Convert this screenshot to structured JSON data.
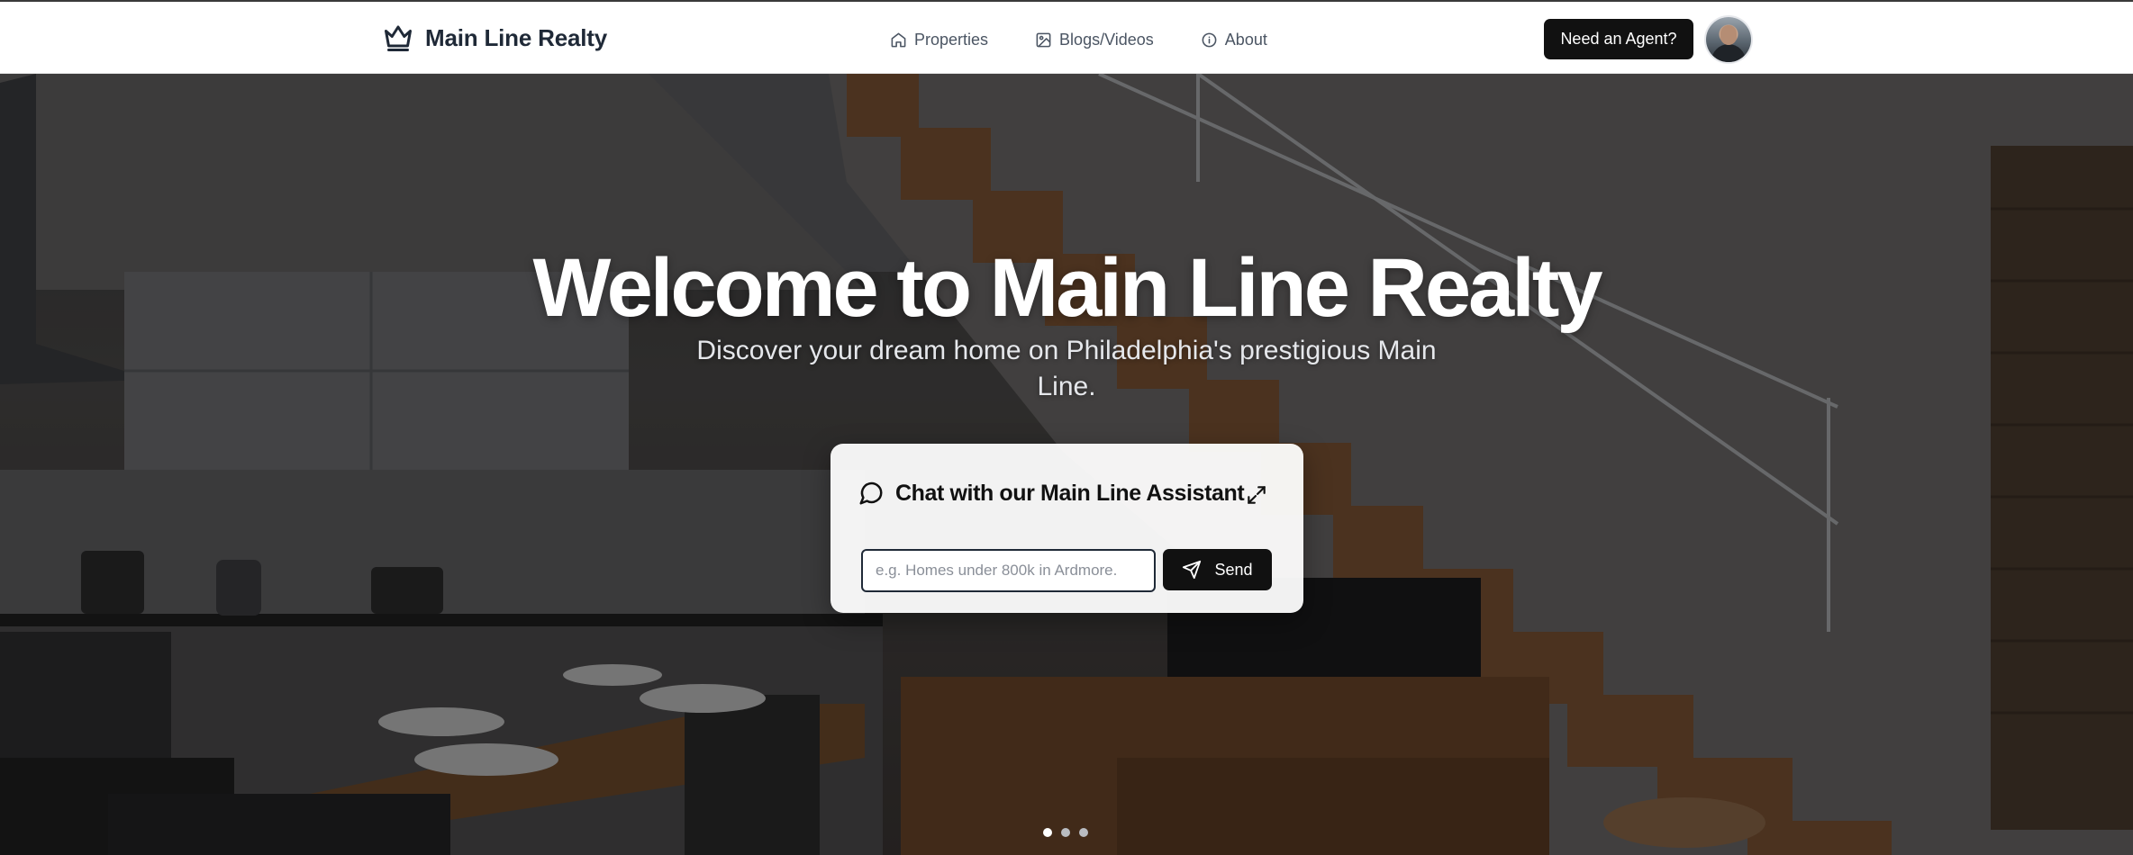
{
  "header": {
    "brand": {
      "name": "Main Line Realty",
      "icon": "crown-icon"
    },
    "nav": [
      {
        "label": "Properties",
        "icon": "home-icon"
      },
      {
        "label": "Blogs/Videos",
        "icon": "image-icon"
      },
      {
        "label": "About",
        "icon": "info-icon"
      }
    ],
    "agent_button": "Need an Agent?",
    "avatar": "user-avatar"
  },
  "hero": {
    "title": "Welcome to Main Line Realty",
    "subtitle": "Discover your dream home on Philadelphia's prestigious Main Line.",
    "background": "kitchen-and-staircase-photo"
  },
  "chat": {
    "title": "Chat with our Main Line Assistant",
    "icon": "chat-bubble-icon",
    "expand_icon": "expand-icon",
    "input_value": "",
    "input_placeholder": "e.g. Homes under 800k in Ardmore.",
    "send_label": "Send",
    "send_icon": "send-icon"
  },
  "carousel": {
    "slide_count": 3,
    "active_index": 0,
    "active_color": "#ffffff",
    "inactive_color": "#b9bcc1"
  },
  "colors": {
    "primary": "#111111",
    "brand_text": "#1f2937",
    "nav_text": "#4b5563"
  }
}
